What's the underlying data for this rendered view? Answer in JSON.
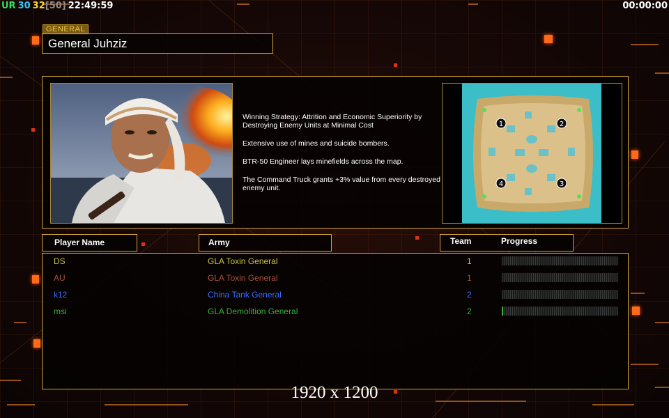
{
  "hud": {
    "left": [
      {
        "text": "UR",
        "color": "#33e15a"
      },
      {
        "text": "30",
        "color": "#35c8ff"
      },
      {
        "text": "32",
        "color": "#ffd832"
      },
      {
        "text": "[50]",
        "color": "#8c8c8c"
      },
      {
        "text": "22:49:59",
        "color": "#ffffff"
      }
    ],
    "timer": "00:00:00"
  },
  "general": {
    "tag": "GENERAL",
    "name": "General Juhziz"
  },
  "description": [
    "Winning Strategy: Attrition and Economic Superiority by Destroying Enemy Units at Minimal Cost",
    "Extensive use of mines and suicide bombers.",
    "BTR-50 Engineer lays minefields across the map.",
    "The Command Truck grants +3% value from every destroyed enemy unit."
  ],
  "map": {
    "start_positions": [
      "1",
      "2",
      "4",
      "3"
    ]
  },
  "headers": {
    "player_name": "Player Name",
    "army": "Army",
    "team": "Team",
    "progress": "Progress"
  },
  "players": [
    {
      "name": "DS",
      "army": "GLA Toxin General",
      "team": "1",
      "color": "#c9c24a",
      "progress": 0.0
    },
    {
      "name": "AU",
      "army": "GLA Toxin General",
      "team": "1",
      "color": "#a8523a",
      "progress": 0.0
    },
    {
      "name": "k12",
      "army": "China Tank General",
      "team": "2",
      "color": "#3a6cff",
      "progress": 0.0
    },
    {
      "name": "msi",
      "army": "GLA Demolition General",
      "team": "2",
      "color": "#3cae3c",
      "progress": 0.01
    }
  ],
  "resolution": "1920 x 1200",
  "colors": {
    "frame": "#d8a830",
    "accent": "#ff6a1a"
  }
}
